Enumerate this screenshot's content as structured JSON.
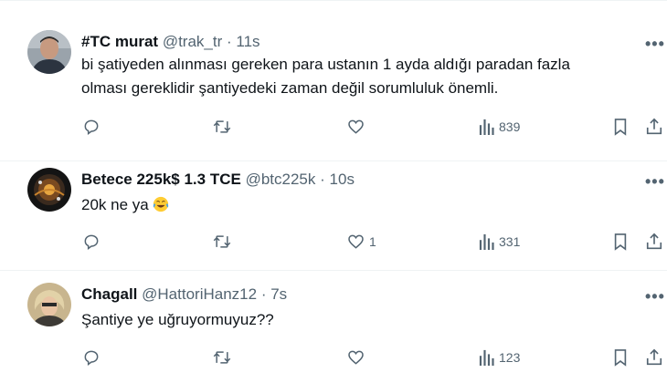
{
  "tweets": [
    {
      "name": "#TC murat",
      "handle": "@trak_tr",
      "dot": "·",
      "time": "11s",
      "text_line1": "bi şatiyeden alınması gereken para ustanın 1 ayda aldığı paradan fazla",
      "text_line2": "olması gereklidir şantiyedeki zaman değil sorumluluk önemli.",
      "replies": "",
      "retweets": "",
      "likes": "",
      "views": "839",
      "more": "•••"
    },
    {
      "name": "Betece 225k$ 1.3 TCE",
      "handle": "@btc225k",
      "dot": "·",
      "time": "10s",
      "text_line1": "20k ne ya",
      "emoji": "face-with-tears-of-joy-icon",
      "replies": "",
      "retweets": "",
      "likes": "1",
      "views": "331",
      "more": "•••"
    },
    {
      "name": "Chagall",
      "handle": "@HattoriHanz12",
      "dot": "·",
      "time": "7s",
      "text_line1": "Şantiye ye uğruyormuyuz??",
      "replies": "",
      "retweets": "",
      "likes": "",
      "views": "123",
      "more": "•••"
    }
  ],
  "icons": [
    "reply-icon",
    "retweet-icon",
    "like-icon",
    "views-icon",
    "bookmark-icon",
    "share-icon",
    "more-icon"
  ],
  "colors": {
    "text": "#0f1419",
    "secondary": "#536471",
    "divider": "#eff3f4"
  }
}
